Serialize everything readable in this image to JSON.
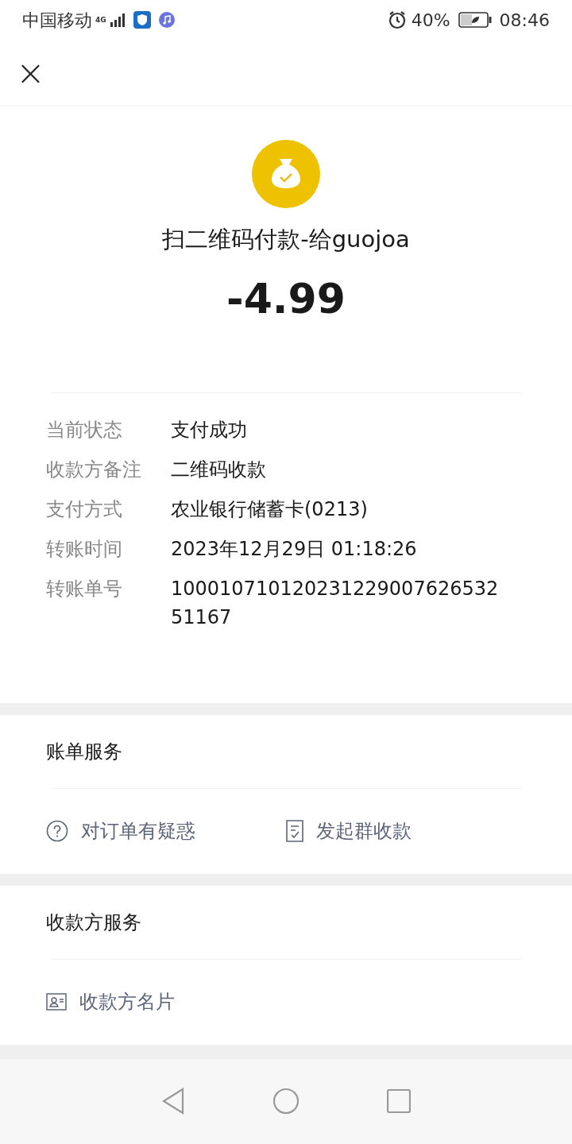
{
  "status_bar": {
    "carrier": "中国移动",
    "network": "4G",
    "battery": "40%",
    "time": "08:46"
  },
  "header": {
    "close": "×"
  },
  "payment": {
    "title": "扫二维码付款-给guojoa",
    "amount": "-4.99"
  },
  "details": [
    {
      "label": "当前状态",
      "value": "支付成功"
    },
    {
      "label": "收款方备注",
      "value": "二维码收款"
    },
    {
      "label": "支付方式",
      "value": "农业银行储蓄卡(0213)"
    },
    {
      "label": "转账时间",
      "value": "2023年12月29日 01:18:26"
    },
    {
      "label": "转账单号",
      "value": "10001071012023122900762653251167"
    }
  ],
  "sections": [
    {
      "title": "账单服务",
      "actions": [
        {
          "kind": "question",
          "label": "对订单有疑惑"
        },
        {
          "kind": "bill",
          "label": "发起群收款"
        }
      ]
    },
    {
      "title": "收款方服务",
      "actions": [
        {
          "kind": "card",
          "label": "收款方名片"
        }
      ]
    }
  ]
}
